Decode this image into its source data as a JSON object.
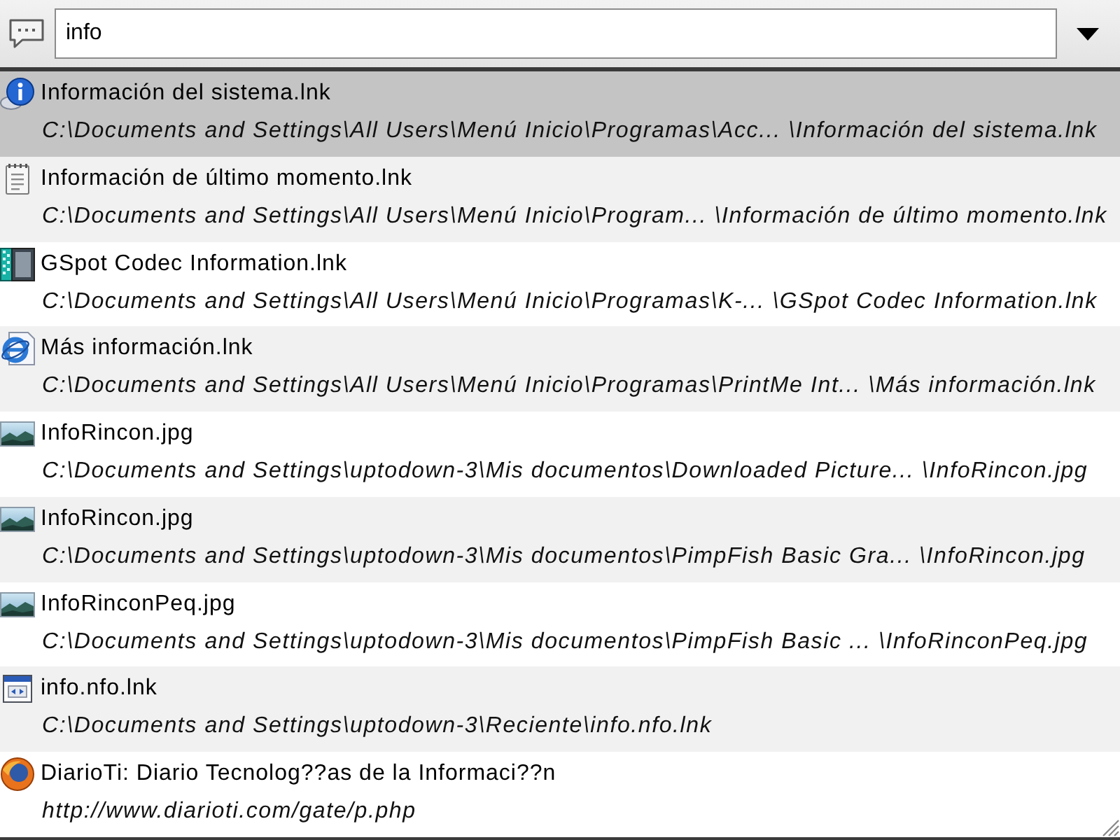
{
  "search": {
    "value": "info"
  },
  "results": [
    {
      "kind": "info",
      "title": "Información del sistema.lnk",
      "location": "C:\\Documents and Settings\\All Users\\Menú Inicio\\Programas\\Acc... \\Información del sistema.lnk",
      "selected": true
    },
    {
      "kind": "notepad",
      "title": "Información de último momento.lnk",
      "location": "C:\\Documents and Settings\\All Users\\Menú Inicio\\Program... \\Información de último momento.lnk",
      "selected": false
    },
    {
      "kind": "filmstrip",
      "title": "GSpot Codec Information.lnk",
      "location": "C:\\Documents and Settings\\All Users\\Menú Inicio\\Programas\\K-... \\GSpot Codec Information.lnk",
      "selected": false
    },
    {
      "kind": "webpage",
      "title": "Más información.lnk",
      "location": "C:\\Documents and Settings\\All Users\\Menú Inicio\\Programas\\PrintMe Int... \\Más información.lnk",
      "selected": false
    },
    {
      "kind": "picture",
      "title": "InfoRincon.jpg",
      "location": "C:\\Documents and Settings\\uptodown-3\\Mis documentos\\Downloaded Picture... \\InfoRincon.jpg",
      "selected": false
    },
    {
      "kind": "picture",
      "title": "InfoRincon.jpg",
      "location": "C:\\Documents and Settings\\uptodown-3\\Mis documentos\\PimpFish Basic Gra... \\InfoRincon.jpg",
      "selected": false
    },
    {
      "kind": "picture",
      "title": "InfoRinconPeq.jpg",
      "location": "C:\\Documents and Settings\\uptodown-3\\Mis documentos\\PimpFish Basic ... \\InfoRinconPeq.jpg",
      "selected": false
    },
    {
      "kind": "window",
      "title": "info.nfo.lnk",
      "location": "C:\\Documents and Settings\\uptodown-3\\Reciente\\info.nfo.lnk",
      "selected": false
    },
    {
      "kind": "globe",
      "title": "DiarioTi: Diario Tecnolog??as de la Informaci??n",
      "location": "http://www.diarioti.com/gate/p.php",
      "selected": false
    }
  ]
}
